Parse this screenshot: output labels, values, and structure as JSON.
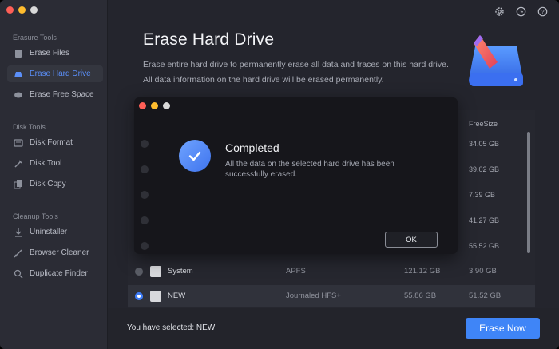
{
  "sidebar": {
    "sections": [
      {
        "title": "Erasure Tools",
        "items": [
          {
            "label": "Erase Files",
            "icon": "erase-files-icon"
          },
          {
            "label": "Erase Hard Drive",
            "icon": "erase-drive-icon",
            "active": true
          },
          {
            "label": "Erase Free Space",
            "icon": "erase-space-icon"
          }
        ]
      },
      {
        "title": "Disk Tools",
        "items": [
          {
            "label": "Disk Format",
            "icon": "disk-format-icon"
          },
          {
            "label": "Disk Tool",
            "icon": "disk-tool-icon"
          },
          {
            "label": "Disk Copy",
            "icon": "disk-copy-icon"
          }
        ]
      },
      {
        "title": "Cleanup Tools",
        "items": [
          {
            "label": "Uninstaller",
            "icon": "uninstaller-icon"
          },
          {
            "label": "Browser Cleaner",
            "icon": "browser-cleaner-icon"
          },
          {
            "label": "Duplicate Finder",
            "icon": "duplicate-finder-icon"
          }
        ]
      }
    ]
  },
  "header": {
    "title": "Erase Hard Drive",
    "description": "Erase entire hard drive to permanently erase all data and traces on this hard drive. All data information on the hard drive will be erased permanently."
  },
  "table": {
    "freesize_header": "FreeSize",
    "freesizes": [
      "34.05 GB",
      "39.02 GB",
      "7.39 GB",
      "41.27 GB",
      "55.52 GB"
    ],
    "rows": [
      {
        "name": "System",
        "format": "APFS",
        "capacity": "121.12 GB",
        "free": "3.90 GB",
        "selected": false
      },
      {
        "name": "NEW",
        "format": "Journaled HFS+",
        "capacity": "55.86 GB",
        "free": "51.52 GB",
        "selected": true
      }
    ]
  },
  "modal": {
    "title": "Completed",
    "message": "All the data on the selected hard drive has been successfully erased.",
    "ok_label": "OK"
  },
  "footer": {
    "selected_text": "You have selected: NEW",
    "erase_label": "Erase Now"
  },
  "colors": {
    "accent": "#3f85f7",
    "sidebar_active": "#5b8ff9"
  }
}
